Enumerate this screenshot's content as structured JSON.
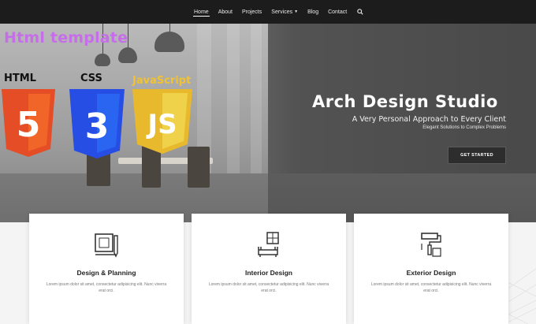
{
  "nav": {
    "items": [
      {
        "label": "Home"
      },
      {
        "label": "About"
      },
      {
        "label": "Projects"
      },
      {
        "label": "Services"
      },
      {
        "label": "Blog"
      },
      {
        "label": "Contact"
      }
    ],
    "search_icon": "search-icon"
  },
  "overlay": {
    "title": "Html template",
    "html_label": "HTML",
    "css_label": "CSS",
    "js_label": "JavaScript",
    "html5_number": "5",
    "css3_number": "3",
    "js_letters": "JS",
    "colors": {
      "title": "#c56ee8",
      "html5": "#e44d26",
      "css3": "#264de4",
      "js": "#f0db4f"
    }
  },
  "hero": {
    "title": "Arch Design Studio",
    "subtitle": "A Very Personal Approach to Every Client",
    "tagline": "Elegant Solutions to Complex Problems",
    "cta": "GET STARTED"
  },
  "cards": [
    {
      "title": "Design & Planning",
      "text": "Lorem ipsum dolor sit amet, consectetur adipisicing elit. Nunc viverra erat orci.",
      "icon": "blueprint-icon"
    },
    {
      "title": "Interior Design",
      "text": "Lorem ipsum dolor sit amet, consectetur adipisicing elit. Nunc viverra erat orci.",
      "icon": "furniture-icon"
    },
    {
      "title": "Exterior Design",
      "text": "Lorem ipsum dolor sit amet, consectetur adipisicing elit. Nunc viverra erat orci.",
      "icon": "paint-roller-icon"
    }
  ]
}
